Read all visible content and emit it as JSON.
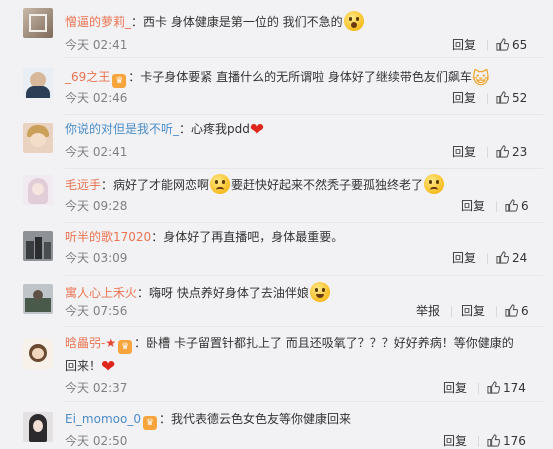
{
  "comments": [
    {
      "username": "憎逼的萝莉_",
      "colon": "：",
      "text_parts": [
        "西卡 身体健康是第一位的 我们不急的"
      ],
      "time": "今天 02:41",
      "reply_label": "回复",
      "likes": "65",
      "emoji": [
        "wow-emoji"
      ]
    },
    {
      "username": "_69之王",
      "colon": "：",
      "text_parts": [
        "卡子身体要紧 直播什么的无所谓啦 身体好了继续带色友们飙车"
      ],
      "time": "今天 02:46",
      "reply_label": "回复",
      "likes": "52",
      "emoji": [
        "cat-emoji"
      ]
    },
    {
      "username": "你说的对但是我不听_",
      "colon": "：",
      "text_parts": [
        "心疼我pdd"
      ],
      "time": "今天 02:41",
      "reply_label": "回复",
      "likes": "23",
      "emoji": [
        "heart-emoji"
      ]
    },
    {
      "username": "毛远手",
      "colon": "：",
      "text_parts": [
        "病好了才能网恋啊",
        "要赶快好起来不然秃子要孤独终老了"
      ],
      "time": "今天 09:28",
      "reply_label": "回复",
      "likes": "6",
      "emoji": [
        "sad-emoji",
        "sad-emoji"
      ]
    },
    {
      "username": "听半的歌17020",
      "colon": "：",
      "text_parts": [
        "身体好了再直播吧，身体最重要。"
      ],
      "time": "今天 03:09",
      "reply_label": "回复",
      "likes": "24"
    },
    {
      "username": "寓人心上禾火",
      "colon": "：",
      "text_parts": [
        "嗨呀 快点养好身体了去油伴娘"
      ],
      "time": "今天 07:56",
      "report_label": "举报",
      "reply_label": "回复",
      "likes": "6",
      "emoji": [
        "smile-emoji"
      ]
    },
    {
      "username": "晗畾弜-",
      "colon": "：",
      "text_parts": [
        "卧槽 卡子留置针都扎上了 而且还吸氧了？？？好好养病！等你健康的",
        "回来！"
      ],
      "time": "今天 02:37",
      "reply_label": "回复",
      "likes": "174",
      "emoji": [
        "heart-emoji"
      ]
    },
    {
      "username": "Ei_momoo_0",
      "colon": "：",
      "text_parts": [
        "我代表德云色女色友等你健康回来"
      ],
      "time": "今天 02:50",
      "reply_label": "回复",
      "likes": "176"
    }
  ],
  "colors": {
    "username": "#eb7350",
    "username_link": "#4b8cc8",
    "time": "#808080",
    "background": "#f2f2f5"
  }
}
